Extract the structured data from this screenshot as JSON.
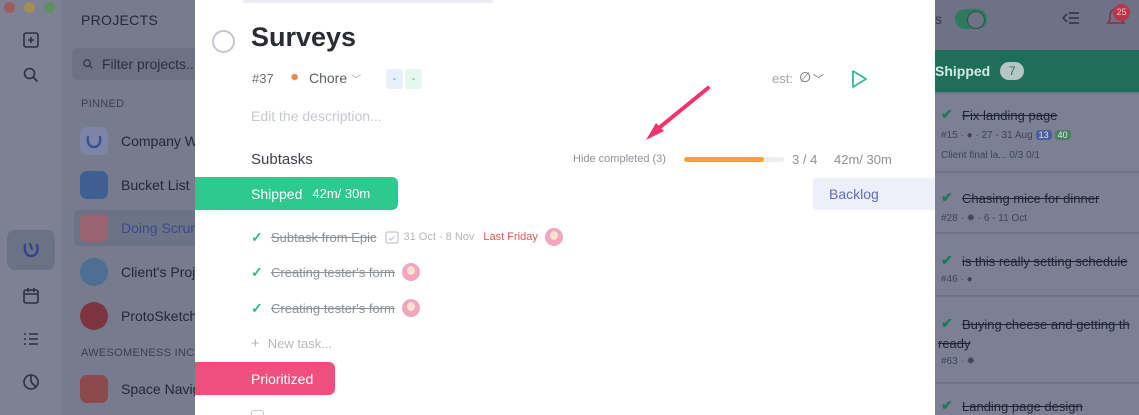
{
  "window": {
    "traffic_lights": [
      "#ee5e57",
      "#f5bd2f",
      "#55c43f"
    ]
  },
  "rail": {
    "icons": [
      "new-task-icon",
      "search-icon",
      "home-logo-icon",
      "calendar-icon",
      "list-icon",
      "reports-icon"
    ]
  },
  "projects": {
    "title": "PROJECTS",
    "filter_placeholder": "Filter projects...",
    "pinned_label": "PINNED",
    "pinned": [
      {
        "name": "Company W",
        "color": "#4a6fd1"
      },
      {
        "name": "Bucket List",
        "color": "#3a76c4"
      },
      {
        "name": "Doing Scrum",
        "color": "#e15c62",
        "selected": true
      },
      {
        "name": "Client's Proj",
        "color": "#4a88c9"
      },
      {
        "name": "ProtoSketch",
        "color": "#c3262e"
      }
    ],
    "group_label": "AWESOMENESS INC",
    "group_items": [
      {
        "name": "Space Navig",
        "color": "#e04b3c"
      }
    ]
  },
  "task": {
    "title": "Surveys",
    "id": "#37",
    "type_label": "Chore",
    "tags": [
      "-",
      "-"
    ],
    "est_label": "est:",
    "est_value": "∅",
    "description_placeholder": "Edit the description...",
    "subtasks_heading": "Subtasks",
    "hide_completed": "Hide completed (3)",
    "progress_fraction": 0.8,
    "progress_count": "3 / 4",
    "progress_time": "42m/ 30m",
    "groups": [
      {
        "label": "Shipped",
        "time": "42m/ 30m",
        "color": "#2dc98e"
      },
      {
        "label": "Prioritized",
        "time": "",
        "color": "#f04f7e"
      }
    ],
    "backlog_label": "Backlog",
    "subtasks": [
      {
        "title": "Subtask from Epic",
        "date": "31 Oct - 8 Nov",
        "due": "Last Friday"
      },
      {
        "title": "Creating tester's form",
        "date": "",
        "due": ""
      },
      {
        "title": "Creating tester's form",
        "date": "",
        "due": ""
      }
    ],
    "new_task_placeholder": "New task..."
  },
  "board": {
    "toggle_label": "s",
    "notification_count": "25",
    "column_title": "Shipped",
    "column_count": "7",
    "cards": [
      {
        "title": "Fix landing page",
        "meta": "#15 · ● · 27 - 31 Aug",
        "chips": [
          "13",
          "40"
        ],
        "extra": "Client final la... 0/3 0/1"
      },
      {
        "title": "Chasing mice for dinner",
        "meta": "#28 · ✹ · 6 - 11 Oct",
        "chips": [],
        "extra": ""
      },
      {
        "title": "is this really setting schedule",
        "meta": "#46 · ●",
        "chips": [],
        "extra": ""
      },
      {
        "title": "Buying cheese and getting th",
        "title2": "ready",
        "meta": "#63 · ✹",
        "chips": [],
        "extra": ""
      },
      {
        "title": "Landing page design",
        "meta": "",
        "chips": [],
        "extra": ""
      }
    ]
  }
}
